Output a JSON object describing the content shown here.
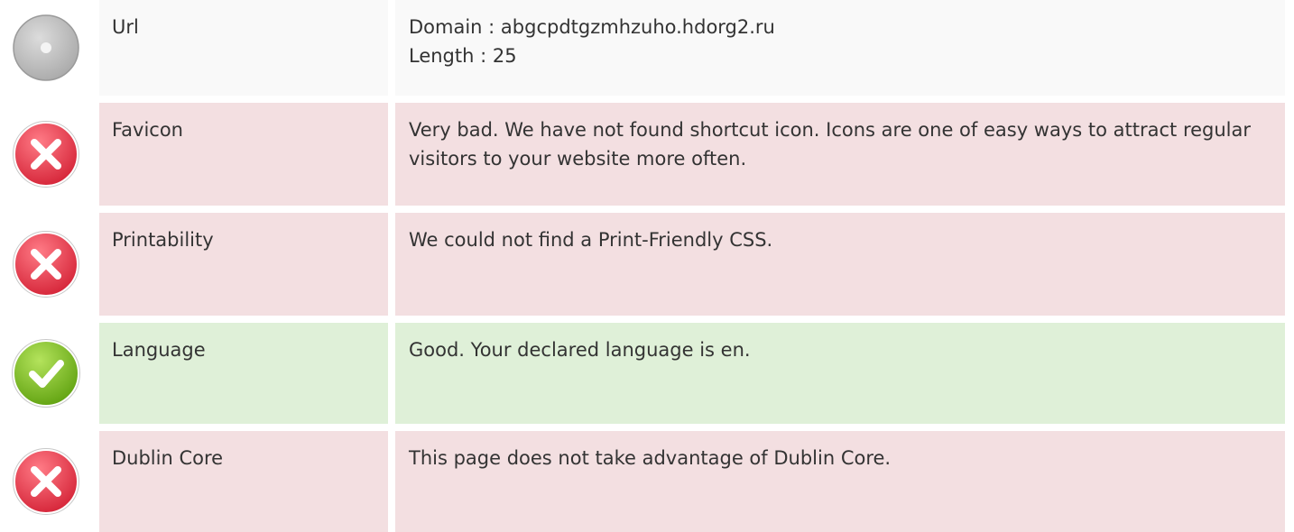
{
  "rows": [
    {
      "status": "neutral",
      "icon": "neutral-dot-icon",
      "label": "Url",
      "lines": [
        "Domain : abgcpdtgzmhzuho.hdorg2.ru",
        "Length : 25"
      ]
    },
    {
      "status": "bad",
      "icon": "error-x-icon",
      "label": "Favicon",
      "lines": [
        "Very bad. We have not found shortcut icon. Icons are one of easy ways to attract regular visitors to your website more often."
      ]
    },
    {
      "status": "bad",
      "icon": "error-x-icon",
      "label": "Printability",
      "lines": [
        "We could not find a Print-Friendly CSS."
      ]
    },
    {
      "status": "good",
      "icon": "success-check-icon",
      "label": "Language",
      "lines": [
        "Good. Your declared language is en."
      ]
    },
    {
      "status": "bad",
      "icon": "error-x-icon",
      "label": "Dublin Core",
      "lines": [
        "This page does not take advantage of Dublin Core."
      ]
    }
  ],
  "colors": {
    "neutral": "#f9f9f9",
    "bad": "#f3dfe1",
    "good": "#dff0d8",
    "error_icon": "#e8384a",
    "success_icon": "#7cbd1e"
  }
}
